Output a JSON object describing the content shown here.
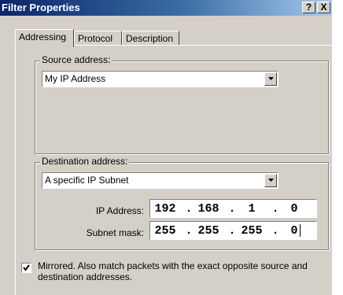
{
  "window": {
    "title": "Filter Properties",
    "help_button": "?",
    "close_button": "X"
  },
  "tabs": [
    {
      "label": "Addressing",
      "active": true
    },
    {
      "label": "Protocol",
      "active": false
    },
    {
      "label": "Description",
      "active": false
    }
  ],
  "source": {
    "group_label": "Source address:",
    "selected": "My IP Address"
  },
  "destination": {
    "group_label": "Destination address:",
    "selected": "A specific IP Subnet",
    "ip_label": "IP Address:",
    "ip_octets": [
      "192",
      "168",
      "1",
      "0"
    ],
    "mask_label": "Subnet mask:",
    "mask_octets": [
      "255",
      "255",
      "255",
      "0"
    ],
    "separator": "."
  },
  "mirrored": {
    "checked": true,
    "text": "Mirrored. Also match packets with the exact opposite source and destination addresses."
  }
}
